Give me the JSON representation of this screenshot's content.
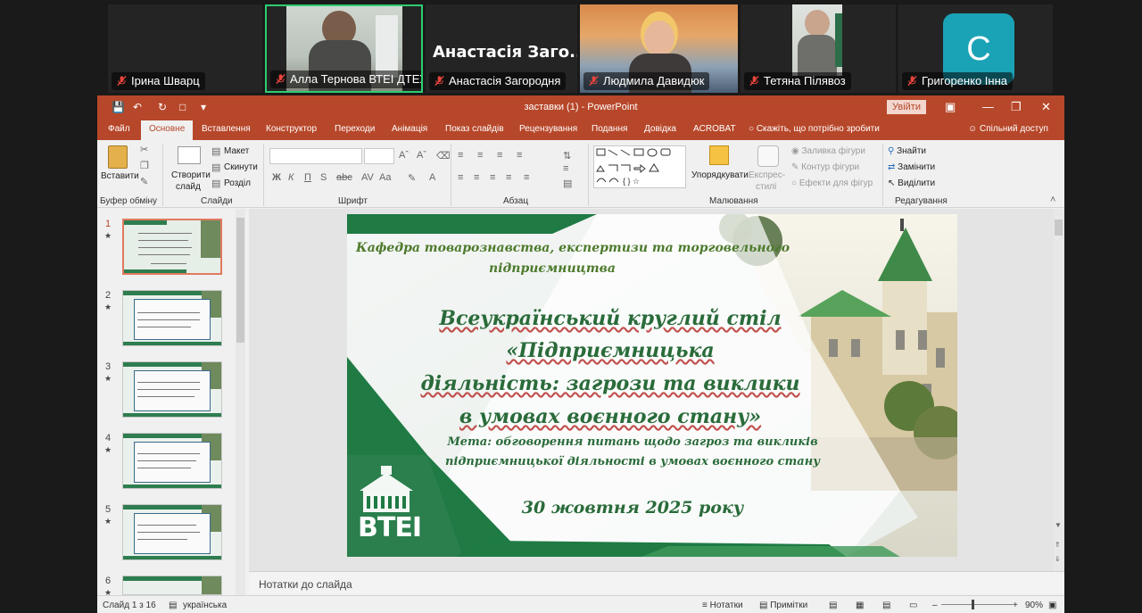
{
  "participants": [
    {
      "name": "Ірина Шварц"
    },
    {
      "name": "Алла Тернова ВТЕІ ДТЕУ"
    },
    {
      "name": "Анастасія Загородня",
      "display": "Анастасія Заго..."
    },
    {
      "name": "Людмила Давидюк"
    },
    {
      "name": "Тетяна Пілявоз"
    },
    {
      "name": "Григоренко Інна",
      "initial": "C"
    }
  ],
  "window": {
    "title": "заставки (1)  -  PowerPoint",
    "signin": "Увійти"
  },
  "tabs": [
    "Файл",
    "Основне",
    "Вставлення",
    "Конструктор",
    "Переходи",
    "Анімація",
    "Показ слайдів",
    "Рецензування",
    "Подання",
    "Довідка",
    "ACROBAT"
  ],
  "tell_me": "Скажіть, що потрібно зробити",
  "share": "Спільний доступ",
  "ribbon": {
    "paste": "Вставити",
    "clipboard": "Буфер обміну",
    "new_slide_1": "Створити",
    "new_slide_2": "слайд",
    "layout": "Макет",
    "reset": "Скинути",
    "section": "Розділ",
    "slides": "Слайди",
    "font": "Шрифт",
    "paragraph": "Абзац",
    "arrange": "Упорядкувати",
    "quick_styles_1": "Експрес-",
    "quick_styles_2": "стилі",
    "shape_fill": "Заливка фігури",
    "shape_outline": "Контур фігури",
    "shape_effects": "Ефекти для фігур",
    "drawing": "Малювання",
    "find": "Знайти",
    "replace": "Замінити",
    "select": "Виділити",
    "editing": "Редагування"
  },
  "slide": {
    "dept": "Кафедра товарознавства, експертизи та торговельного",
    "dept2": "підприємництва",
    "event1": "Всеукраїнський круглий стіл",
    "event2": "«Підприємницька",
    "event3": "діяльність: загрози та виклики",
    "event4": "в умовах воєнного стану»",
    "goal1": "Мета: обговорення питань щодо загроз та викликів",
    "goal2": "підприємницької діяльності в умовах воєнного стану",
    "date": "30 жовтня 2025 року",
    "logo": "ВТЕІ"
  },
  "thumb_numbers": [
    "1",
    "2",
    "3",
    "4",
    "5",
    "6"
  ],
  "notes_placeholder": "Нотатки до слайда",
  "status": {
    "slide_of": "Слайд 1 з 16",
    "language": "українська",
    "notes": "Нотатки",
    "comments": "Примітки",
    "zoom": "90%"
  },
  "colors": {
    "accent": "#b7472a",
    "slide_green": "#1f7a44",
    "slide_text": "#2a6b3a"
  }
}
